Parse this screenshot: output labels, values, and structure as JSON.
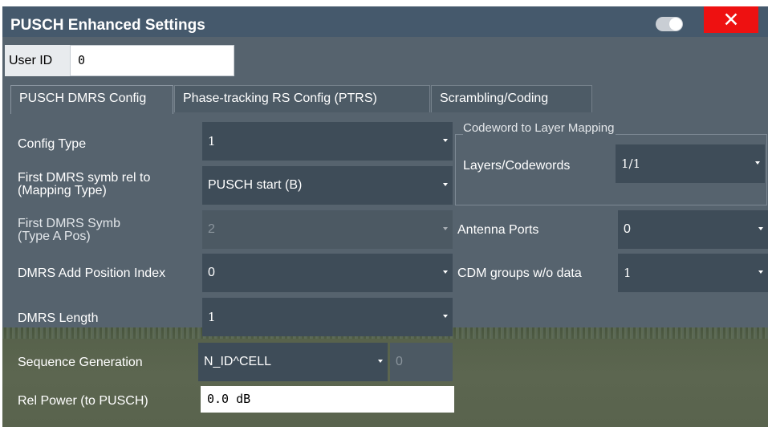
{
  "window": {
    "title": "PUSCH Enhanced Settings",
    "close_label": "✕"
  },
  "user_id": {
    "label": "User ID",
    "value": "0"
  },
  "tabs": [
    {
      "label": "PUSCH DMRS Config"
    },
    {
      "label": "Phase-tracking RS Config (PTRS)"
    },
    {
      "label": "Scrambling/Coding"
    }
  ],
  "left": {
    "config_type": {
      "label": "Config Type",
      "value": "1"
    },
    "first_dmrs_rel": {
      "label": "First DMRS symb rel to\n(Mapping Type)",
      "value": "PUSCH start (B)"
    },
    "first_dmrs_symb": {
      "label": "First DMRS Symb\n(Type A Pos)",
      "value": "2"
    },
    "add_position": {
      "label": "DMRS Add Position Index",
      "value": "0"
    },
    "dmrs_length": {
      "label": "DMRS Length",
      "value": "1"
    },
    "seq_gen": {
      "label": "Sequence Generation",
      "value": "N_ID^CELL",
      "extra_value": "0"
    },
    "rel_power": {
      "label": "Rel Power (to PUSCH)",
      "value": "0.0 dB"
    }
  },
  "right": {
    "group_title": "Codeword to Layer Mapping",
    "layers": {
      "label": "Layers/Codewords",
      "value": "1/1"
    },
    "antenna_ports": {
      "label": "Antenna Ports",
      "value": "0"
    },
    "cdm_groups": {
      "label": "CDM groups w/o data",
      "value": "1"
    }
  },
  "colors": {
    "titlebar": "#45596c",
    "panel": "#56636e",
    "field": "#3e4c58",
    "close": "#ee1111"
  }
}
